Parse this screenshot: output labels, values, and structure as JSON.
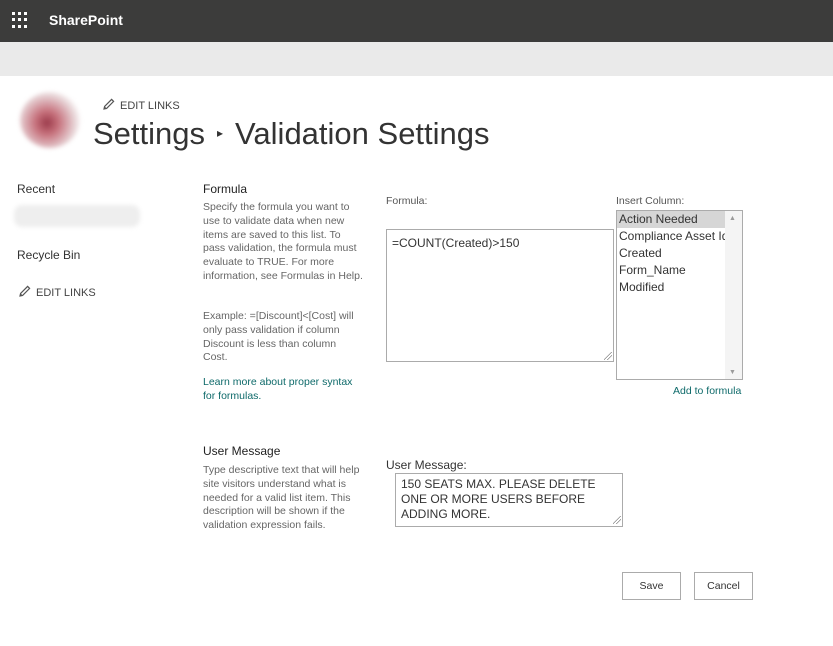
{
  "header": {
    "brand": "SharePoint"
  },
  "site": {
    "edit_links_label": "EDIT LINKS"
  },
  "title": {
    "parent": "Settings",
    "separator": "▸",
    "current": "Validation Settings"
  },
  "left_nav": {
    "recent": "Recent",
    "recycle_bin": "Recycle Bin",
    "edit_links": "EDIT LINKS"
  },
  "formula_section": {
    "heading": "Formula",
    "description": "Specify the formula you want to use to validate data when new items are saved to this list. To pass validation, the formula must evaluate to TRUE. For more information, see Formulas in Help.",
    "example": "Example: =[Discount]<[Cost] will only pass validation if column Discount is less than column Cost.",
    "learn_more_link": "Learn more about proper syntax for formulas.",
    "formula_label": "Formula:",
    "formula_value": "=COUNT(Created)>150",
    "insert_column_label": "Insert Column:",
    "columns": [
      "Action Needed",
      "Compliance Asset Id",
      "Created",
      "Form_Name",
      "Modified"
    ],
    "selected_column": "Action Needed",
    "add_to_formula": "Add to formula"
  },
  "message_section": {
    "heading": "User Message",
    "description": "Type descriptive text that will help site visitors understand what is needed for a valid list item. This description will be shown if the validation expression fails.",
    "message_label": "User Message:",
    "message_value": "150 SEATS MAX.  PLEASE DELETE ONE OR MORE USERS BEFORE ADDING MORE."
  },
  "buttons": {
    "save": "Save",
    "cancel": "Cancel"
  },
  "icons": {
    "app_launcher": "waffle-icon",
    "edit": "pencil-icon",
    "scroll_up": "chevron-up-icon",
    "scroll_down": "chevron-down-icon"
  },
  "colors": {
    "topbar": "#3c3c3b",
    "subbar": "#eaeaea",
    "link": "#0e6a6a"
  }
}
